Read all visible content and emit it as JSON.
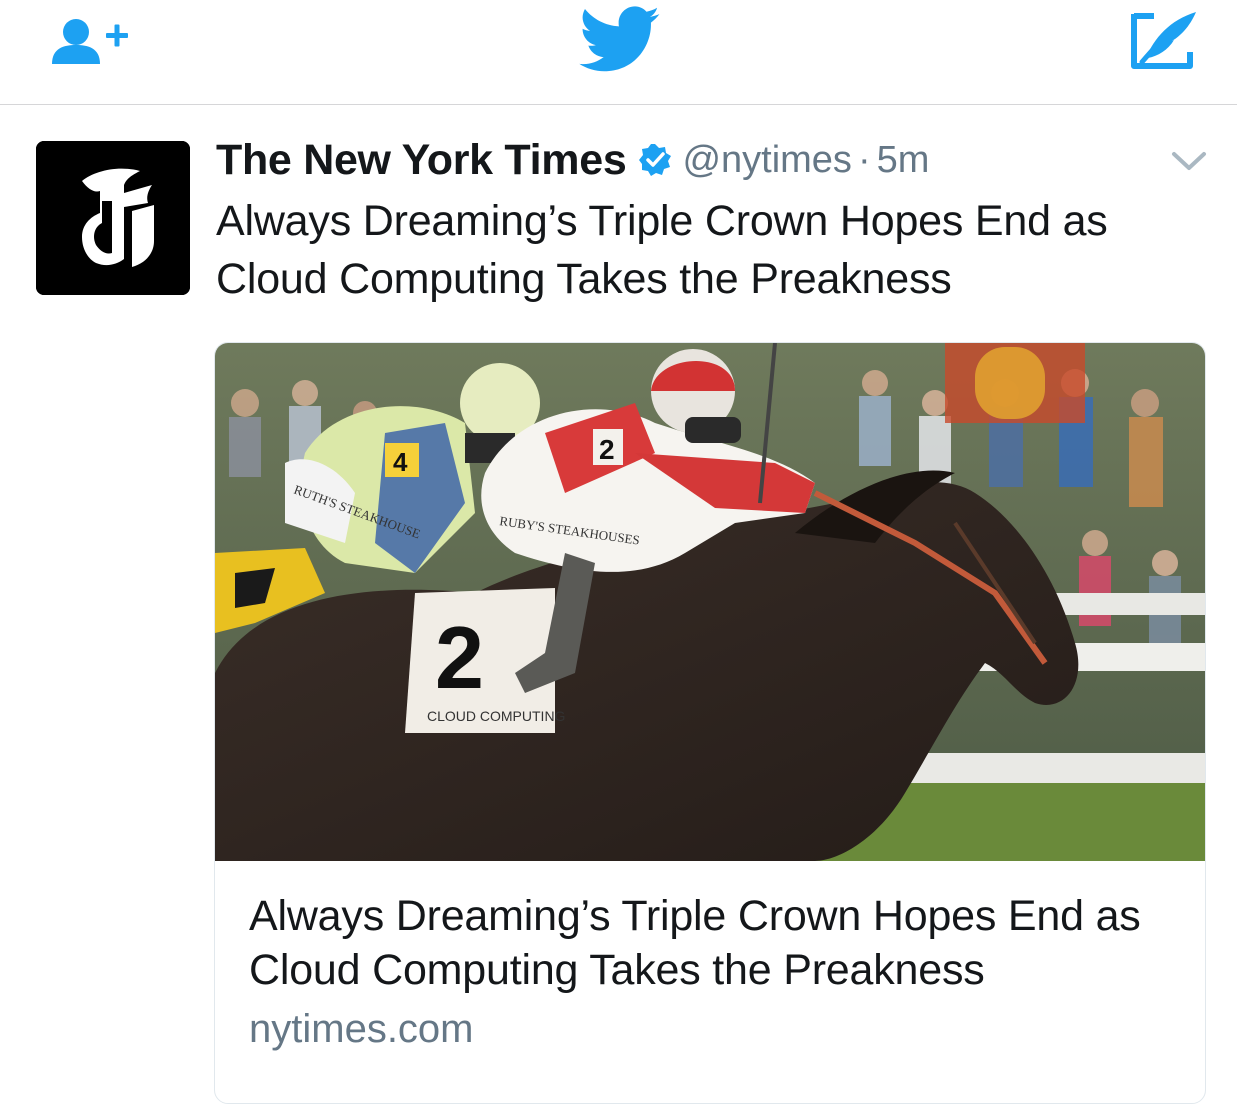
{
  "navbar": {
    "icons": [
      "add-user-icon",
      "twitter-bird-icon",
      "compose-tweet-icon"
    ],
    "accent_color": "#1da1f2"
  },
  "tweet": {
    "avatar_icon": "nyt-t-logo",
    "display_name": "The New York Times",
    "verified": true,
    "handle": "@nytimes",
    "separator": "·",
    "time": "5m",
    "text": "Always Dreaming’s Triple Crown Hopes End as Cloud Computing Takes the Preakness"
  },
  "card": {
    "image_icon": "horse-race-photo",
    "title": "Always Dreaming’s Triple Crown Hopes End as Cloud Computing Takes the Preakness",
    "domain": "nytimes.com",
    "saddle_cloth_number": "2",
    "saddle_cloth_name": "CLOUD COMPUTING",
    "jockey_left_number": "4",
    "jockey_left_sponsor": "RUTH'S STEAKHOUSE",
    "jockey_right_number": "2",
    "jockey_right_sponsor": "RUBY'S STEAKHOUSES"
  }
}
